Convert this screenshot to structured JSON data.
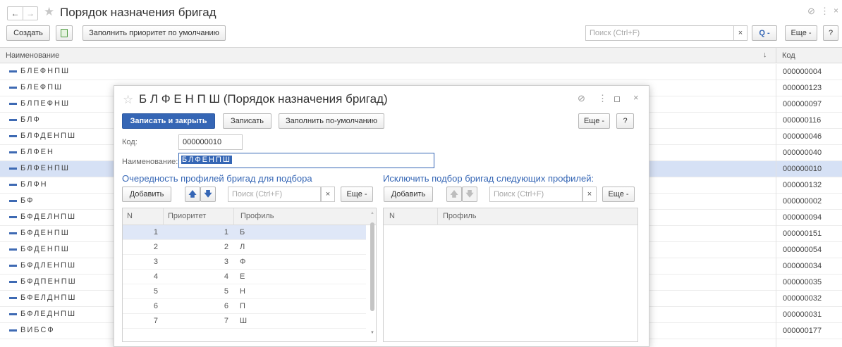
{
  "window": {
    "title": "Порядок назначения бригад",
    "link_icon": "link-icon",
    "more_icon": "kebab-icon",
    "close_icon": "close-icon"
  },
  "toolbar": {
    "create_label": "Создать",
    "fill_priority_label": "Заполнить приоритет по умолчанию",
    "search_placeholder": "Поиск (Ctrl+F)",
    "clear_label": "×",
    "search_btn_label": "Q -",
    "more_label": "Еще -",
    "help_label": "?"
  },
  "list": {
    "columns": {
      "name": "Наименование",
      "sort": "↓",
      "code": "Код"
    },
    "rows": [
      {
        "name": "БЛЕФНПШ",
        "code": "000000004"
      },
      {
        "name": "БЛЕФПШ",
        "code": "000000123"
      },
      {
        "name": "БЛПЕФНШ",
        "code": "000000097"
      },
      {
        "name": "БЛФ",
        "code": "000000116"
      },
      {
        "name": "БЛФДЕНПШ",
        "code": "000000046"
      },
      {
        "name": "БЛФЕН",
        "code": "000000040"
      },
      {
        "name": "БЛФЕНПШ",
        "code": "000000010",
        "selected": true
      },
      {
        "name": "БЛФН",
        "code": "000000132"
      },
      {
        "name": "БФ",
        "code": "000000002"
      },
      {
        "name": "БФДЕЛНПШ",
        "code": "000000094"
      },
      {
        "name": "БФДЕНПШ",
        "code": "000000151"
      },
      {
        "name": "БФДЕНПШ",
        "code": "000000054"
      },
      {
        "name": "БФДЛЕНПШ",
        "code": "000000034"
      },
      {
        "name": "БФДПЕНПШ",
        "code": "000000035"
      },
      {
        "name": "БФЕЛДНПШ",
        "code": "000000032"
      },
      {
        "name": "БФЛЕДНПШ",
        "code": "000000031"
      },
      {
        "name": "ВИБСФ",
        "code": "000000177"
      }
    ]
  },
  "dialog": {
    "title": "Б Л Ф Е Н П Ш (Порядок назначения бригад)",
    "save_close_label": "Записать и закрыть",
    "save_label": "Записать",
    "fill_default_label": "Заполнить по-умолчанию",
    "more_label": "Еще -",
    "help_label": "?",
    "code_label": "Код:",
    "code_value": "000000010",
    "name_label": "Наименование:",
    "name_value": "БЛФЕНПШ",
    "left": {
      "title": "Очередность профилей бригад для подбора",
      "add_label": "Добавить",
      "search_placeholder": "Поиск (Ctrl+F)",
      "clear_label": "×",
      "more_label": "Еще -",
      "columns": {
        "n": "N",
        "priority": "Приоритет",
        "profile": "Профиль"
      },
      "rows": [
        {
          "n": "1",
          "priority": "1",
          "profile": "Б"
        },
        {
          "n": "2",
          "priority": "2",
          "profile": "Л"
        },
        {
          "n": "3",
          "priority": "3",
          "profile": "Ф"
        },
        {
          "n": "4",
          "priority": "4",
          "profile": "Е"
        },
        {
          "n": "5",
          "priority": "5",
          "profile": "Н"
        },
        {
          "n": "6",
          "priority": "6",
          "profile": "П"
        },
        {
          "n": "7",
          "priority": "7",
          "profile": "Ш"
        }
      ]
    },
    "right": {
      "title": "Исключить подбор бригад следующих профилей:",
      "add_label": "Добавить",
      "search_placeholder": "Поиск (Ctrl+F)",
      "clear_label": "×",
      "more_label": "Еще -",
      "columns": {
        "n": "N",
        "profile": "Профиль"
      }
    }
  }
}
